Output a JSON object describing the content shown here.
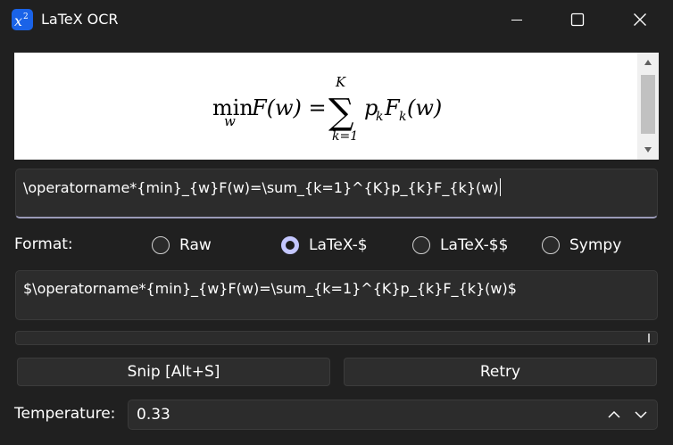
{
  "window": {
    "title": "LaTeX OCR",
    "icon": "x-squared-icon"
  },
  "preview": {
    "formula_parts": {
      "min": "min",
      "min_sub": "w",
      "lhs": "F(w) =",
      "sum_upper": "K",
      "sum_lower": "k=1",
      "rhs_p": "p",
      "rhs_p_sub": "k",
      "rhs_f": "F",
      "rhs_f_sub": "k",
      "rhs_end": "(w)"
    }
  },
  "latex_input": {
    "value": "\\operatorname*{min}_{w}F(w)=\\sum_{k=1}^{K}p_{k}F_{k}(w)"
  },
  "format": {
    "label": "Format:",
    "options": [
      {
        "label": "Raw",
        "checked": false
      },
      {
        "label": "LaTeX-$",
        "checked": true
      },
      {
        "label": "LaTeX-$$",
        "checked": false
      },
      {
        "label": "Sympy",
        "checked": false
      }
    ]
  },
  "output": {
    "value": "$\\operatorname*{min}_{w}F(w)=\\sum_{k=1}^{K}p_{k}F_{k}(w)$"
  },
  "buttons": {
    "snip": "Snip [Alt+S]",
    "retry": "Retry"
  },
  "temperature": {
    "label": "Temperature:",
    "value": "0.33"
  },
  "colors": {
    "background": "#202020",
    "accent": "#c4c7ff",
    "icon_blue": "#1a63e8"
  }
}
